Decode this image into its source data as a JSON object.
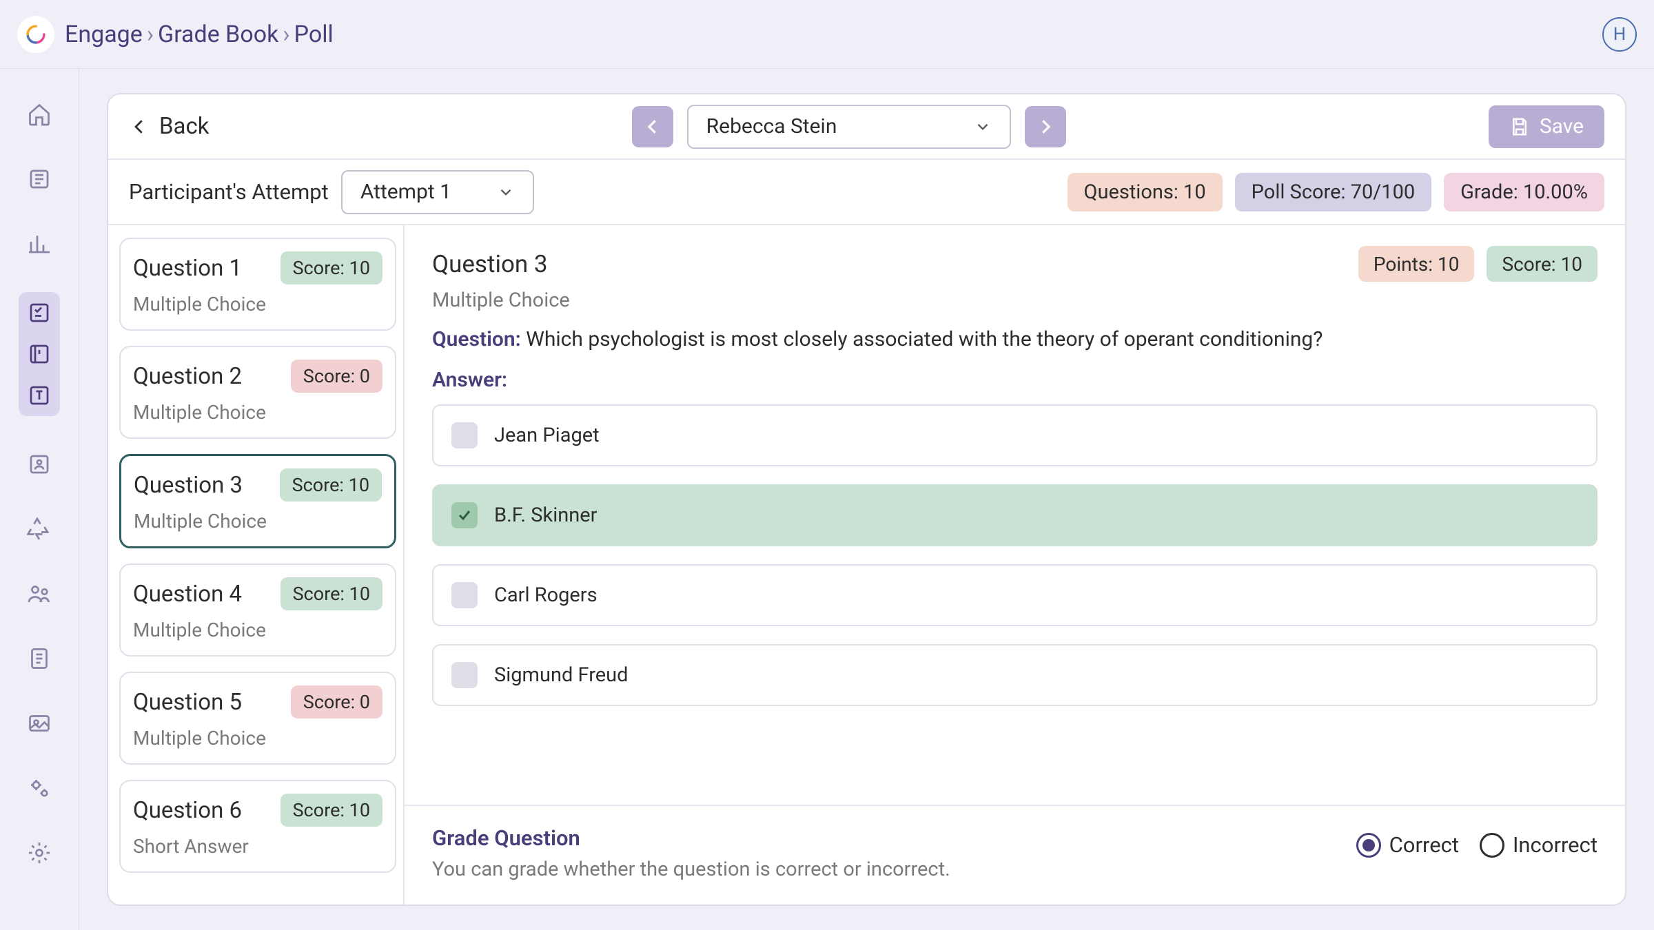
{
  "header": {
    "breadcrumb": [
      "Engage",
      "Grade Book",
      "Poll"
    ],
    "avatar_initial": "H"
  },
  "rail": {
    "items": [
      "home",
      "courses",
      "analytics",
      "grades",
      "library",
      "text",
      "enroll",
      "recycle",
      "users",
      "notes",
      "media",
      "gears",
      "settings"
    ]
  },
  "panel_top": {
    "back_label": "Back",
    "participant": "Rebecca Stein",
    "save_label": "Save"
  },
  "panel_info": {
    "attempt_label": "Participant's Attempt",
    "attempt_value": "Attempt 1",
    "questions_stat": "Questions: 10",
    "score_stat": "Poll Score: 70/100",
    "grade_stat": "Grade: 10.00%"
  },
  "questions": [
    {
      "title": "Question 1",
      "score_label": "Score: 10",
      "score_state": "green",
      "type": "Multiple Choice",
      "selected": false
    },
    {
      "title": "Question 2",
      "score_label": "Score: 0",
      "score_state": "red",
      "type": "Multiple Choice",
      "selected": false
    },
    {
      "title": "Question 3",
      "score_label": "Score: 10",
      "score_state": "green",
      "type": "Multiple Choice",
      "selected": true
    },
    {
      "title": "Question 4",
      "score_label": "Score: 10",
      "score_state": "green",
      "type": "Multiple Choice",
      "selected": false
    },
    {
      "title": "Question 5",
      "score_label": "Score: 0",
      "score_state": "red",
      "type": "Multiple Choice",
      "selected": false
    },
    {
      "title": "Question 6",
      "score_label": "Score: 10",
      "score_state": "green",
      "type": "Short Answer",
      "selected": false
    }
  ],
  "detail": {
    "title": "Question 3",
    "points_label": "Points: 10",
    "score_label": "Score: 10",
    "type": "Multiple Choice",
    "question_lead": "Question:",
    "question_text": "Which psychologist is most closely associated with the theory of operant conditioning?",
    "answer_lead": "Answer:",
    "options": [
      {
        "label": "Jean Piaget",
        "selected_correct": false
      },
      {
        "label": "B.F. Skinner",
        "selected_correct": true
      },
      {
        "label": "Carl Rogers",
        "selected_correct": false
      },
      {
        "label": "Sigmund Freud",
        "selected_correct": false
      }
    ]
  },
  "grade": {
    "title": "Grade Question",
    "desc": "You can grade whether the question is correct or incorrect.",
    "correct_label": "Correct",
    "incorrect_label": "Incorrect",
    "selected": "correct"
  }
}
